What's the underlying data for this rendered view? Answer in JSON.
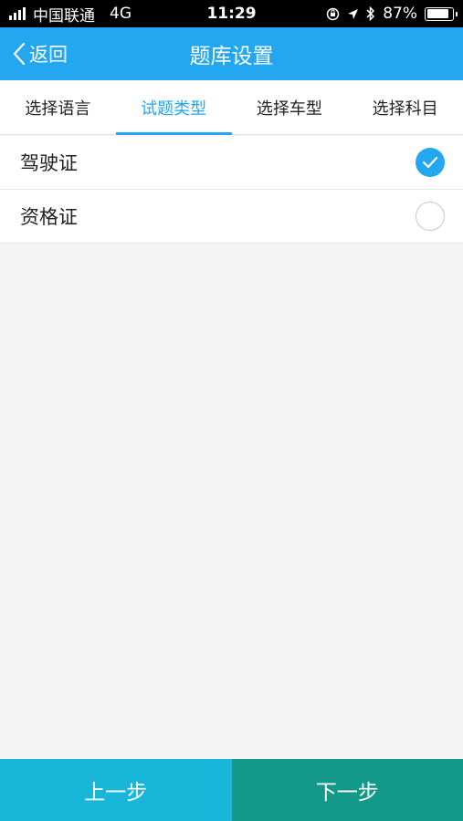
{
  "status_bar": {
    "carrier": "中国联通",
    "network": "4G",
    "time": "11:29",
    "battery_text": "87%",
    "battery_level": 0.87
  },
  "nav": {
    "back_label": "返回",
    "title": "题库设置"
  },
  "tabs": [
    {
      "label": "选择语言",
      "active": false
    },
    {
      "label": "试题类型",
      "active": true
    },
    {
      "label": "选择车型",
      "active": false
    },
    {
      "label": "选择科目",
      "active": false
    }
  ],
  "options": [
    {
      "label": "驾驶证",
      "checked": true
    },
    {
      "label": "资格证",
      "checked": false
    }
  ],
  "bottom": {
    "prev_label": "上一步",
    "next_label": "下一步"
  },
  "colors": {
    "accent": "#22a7f0",
    "prev_button": "#18b6d8",
    "next_button": "#12998a"
  }
}
